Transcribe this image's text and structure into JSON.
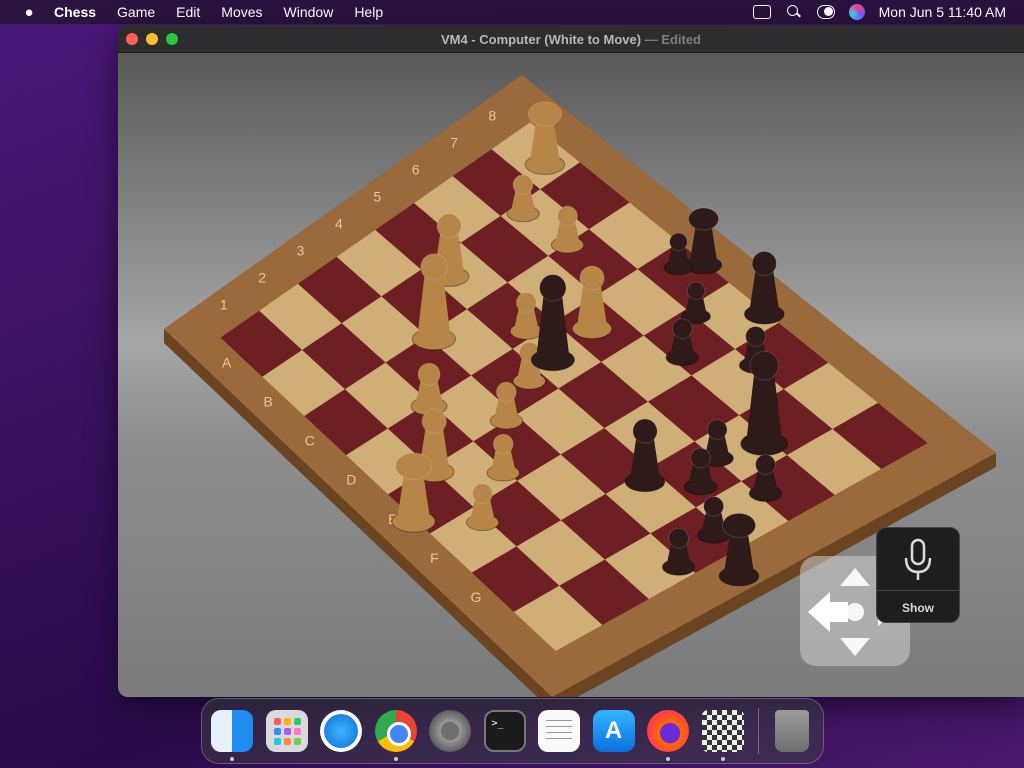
{
  "menubar": {
    "apple_icon": "apple-logo-icon",
    "app_name": "Chess",
    "menus": [
      "Game",
      "Edit",
      "Moves",
      "Window",
      "Help"
    ],
    "status_icons": [
      "screen-mirroring-icon",
      "spotlight-search-icon",
      "control-center-icon",
      "siri-icon"
    ],
    "datetime": "Mon Jun 5  11:40 AM"
  },
  "window": {
    "title_main": "VM4 - Computer   (White to Move)",
    "title_suffix": " — Edited"
  },
  "board": {
    "rank_labels": [
      "1",
      "2",
      "3",
      "4",
      "5",
      "6",
      "7",
      "8"
    ],
    "file_labels": [
      "A",
      "B",
      "C",
      "D",
      "E",
      "F",
      "G"
    ],
    "light_square_color": "#cfae78",
    "dark_square_color": "#6e1f24",
    "frame_color": "#9b6a3c",
    "white_piece_color": "#b78547",
    "black_piece_color": "#2e1a18"
  },
  "voice_control": {
    "mic_icon": "microphone-icon",
    "label": "Show"
  },
  "dpad": {
    "icon": "directional-pad-icon"
  },
  "dock": {
    "apps": [
      {
        "name": "Finder",
        "running": true
      },
      {
        "name": "Launchpad",
        "running": false
      },
      {
        "name": "Safari",
        "running": false
      },
      {
        "name": "Google Chrome",
        "running": true
      },
      {
        "name": "System Settings",
        "running": false
      },
      {
        "name": "Terminal",
        "running": false
      },
      {
        "name": "TextEdit",
        "running": false
      },
      {
        "name": "App Store",
        "running": false
      },
      {
        "name": "Firefox",
        "running": true
      },
      {
        "name": "Chess",
        "running": true
      }
    ],
    "trash": "Trash",
    "terminal_glyph": ">_",
    "appstore_glyph": "A"
  }
}
